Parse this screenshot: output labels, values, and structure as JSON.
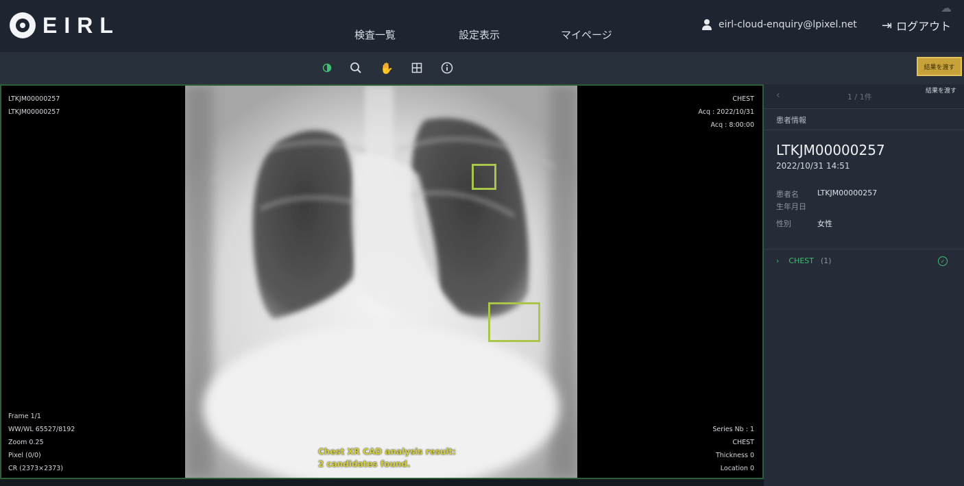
{
  "header": {
    "logo_text": "EIRL",
    "nav": [
      {
        "label": "検査一覧"
      },
      {
        "label": "設定表示"
      },
      {
        "label": "マイページ"
      }
    ],
    "user_email": "eirl-cloud-enquiry@lpixel.net",
    "logout_label": "ログアウト"
  },
  "toolbar": {
    "tools": [
      {
        "icon": "contrast-icon",
        "active": true
      },
      {
        "icon": "zoom-icon",
        "active": false
      },
      {
        "icon": "pan-hand-icon",
        "active": false
      },
      {
        "icon": "layout-grid-icon",
        "active": false
      },
      {
        "icon": "info-icon",
        "active": false
      }
    ],
    "report_button_label": "結果を渡す"
  },
  "viewer": {
    "top_left": [
      "LTKJM00000257",
      "LTKJM00000257"
    ],
    "top_right": [
      "CHEST",
      "Acq : 2022/10/31",
      "Acq : 8:00:00"
    ],
    "bottom_left": [
      "Frame 1/1",
      "WW/WL 65527/8192",
      "Zoom 0.25",
      "Pixel (0/0)",
      "CR (2373×2373)"
    ],
    "bottom_right": [
      "Series Nb : 1",
      "CHEST",
      "Thickness 0",
      "Location 0"
    ],
    "cad_message": [
      "Chest XR CAD analysis result:",
      "2 candidates found."
    ]
  },
  "side_panel": {
    "tab_count": "1 / 1件",
    "action_label": "結果を渡す",
    "section_title": "患者情報",
    "patient_id": "LTKJM00000257",
    "study_datetime": "2022/10/31 14:51",
    "info": [
      {
        "label": "患者名",
        "value": "LTKJM00000257"
      },
      {
        "label": "生年月日",
        "value": ""
      },
      {
        "label": "性別",
        "value": "女性"
      }
    ],
    "series_label": "CHEST",
    "series_count": "(1)"
  },
  "colors": {
    "accent_green": "#3fbf73",
    "cad_box": "#a8c64a",
    "report_button": "#c7a23a"
  }
}
